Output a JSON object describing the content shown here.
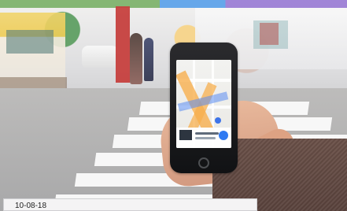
{
  "photo": {
    "subject": "hand-holding-smartphone-with-map",
    "date_label": "10-08-18"
  },
  "colors": {
    "frame": "#7a4fb3",
    "label_background": "#f4f3f4",
    "label_text": "#1e1e1e"
  }
}
